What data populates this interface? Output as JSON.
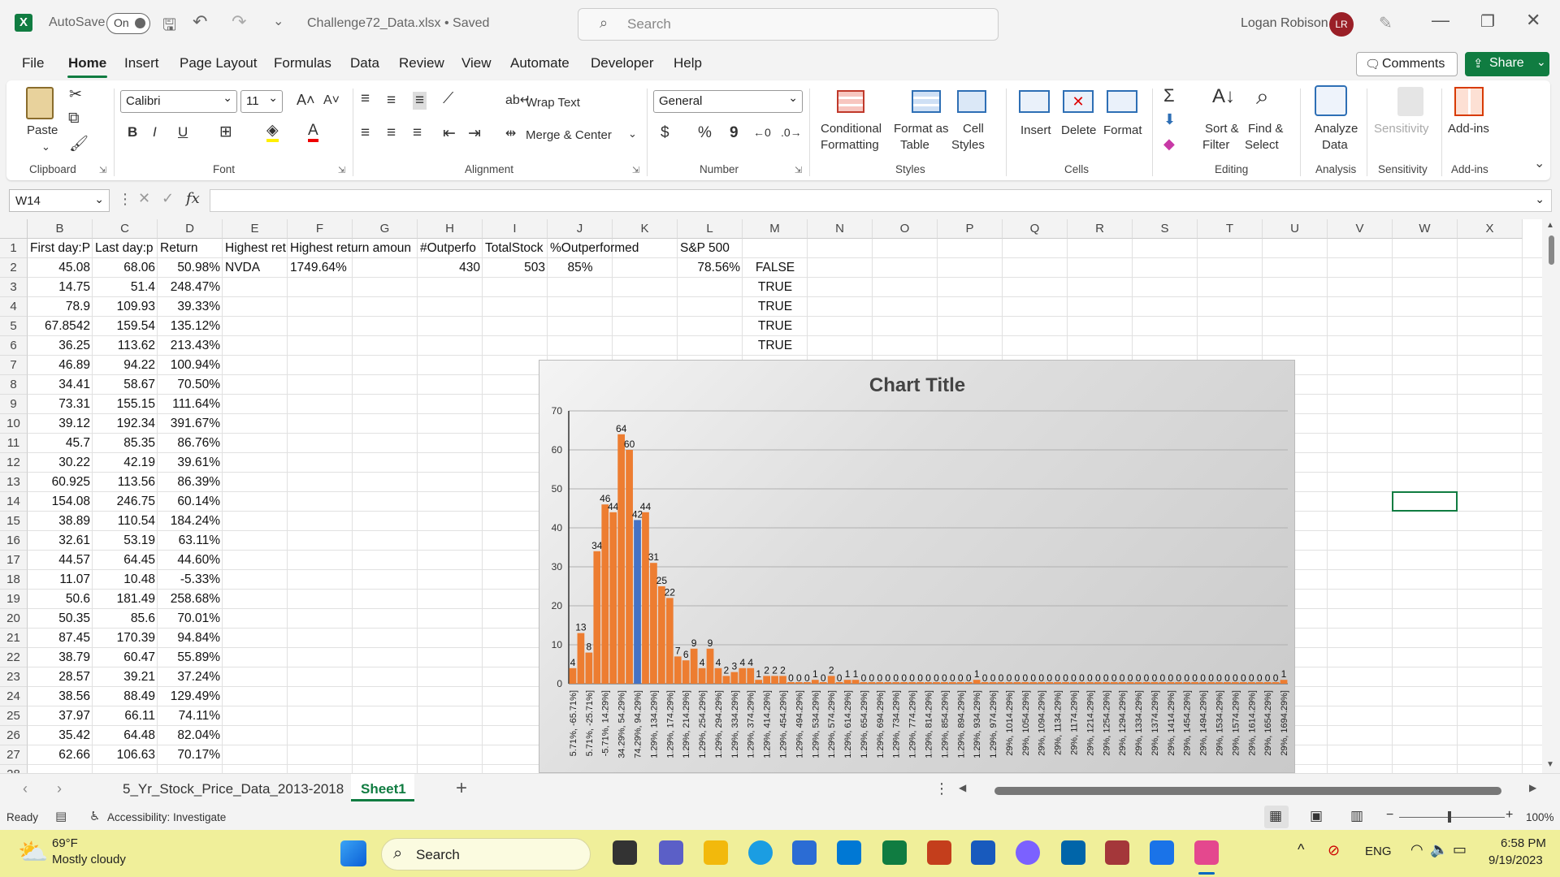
{
  "titlebar": {
    "autosave_label": "AutoSave",
    "autosave_state": "On",
    "filename": "Challenge72_Data.xlsx • Saved",
    "search_placeholder": "Search",
    "user_name": "Logan Robison",
    "user_initials": "LR"
  },
  "menu": {
    "items": [
      "File",
      "Home",
      "Insert",
      "Page Layout",
      "Formulas",
      "Data",
      "Review",
      "View",
      "Automate",
      "Developer",
      "Help"
    ],
    "active": "Home",
    "comments_label": "Comments",
    "share_label": "Share"
  },
  "ribbon": {
    "paste_label": "Paste",
    "clipboard_group": "Clipboard",
    "font_name": "Calibri",
    "font_size": "11",
    "font_group": "Font",
    "wrap_text_label": "Wrap Text",
    "merge_center_label": "Merge & Center",
    "alignment_group": "Alignment",
    "number_format": "General",
    "number_group": "Number",
    "conditional_formatting_label": [
      "Conditional",
      "Formatting"
    ],
    "format_as_table_label": [
      "Format as",
      "Table"
    ],
    "cell_styles_label": [
      "Cell",
      "Styles"
    ],
    "styles_group": "Styles",
    "insert_label": "Insert",
    "delete_label": "Delete",
    "format_label": "Format",
    "cells_group": "Cells",
    "sort_filter_label": [
      "Sort &",
      "Filter"
    ],
    "find_select_label": [
      "Find &",
      "Select"
    ],
    "editing_group": "Editing",
    "analyze_data_label": [
      "Analyze",
      "Data"
    ],
    "analysis_group": "Analysis",
    "sensitivity_label": "Sensitivity",
    "sensitivity_group": "Sensitivity",
    "addins_label": "Add-ins",
    "addins_group": "Add-ins"
  },
  "formula_bar": {
    "name_box": "W14",
    "fx_label": "fx",
    "formula": ""
  },
  "grid": {
    "columns": [
      "B",
      "C",
      "D",
      "E",
      "F",
      "G",
      "H",
      "I",
      "J",
      "K",
      "L",
      "M",
      "N",
      "O",
      "P",
      "Q",
      "R",
      "S",
      "T",
      "U",
      "V",
      "W",
      "X"
    ],
    "header_row": {
      "B": "First day:P",
      "C": "Last day:p",
      "D": "Return",
      "E": "Highest ret",
      "F": "Highest return amoun",
      "H": "#Outperfo",
      "I": "TotalStock",
      "J": "%Outperformed",
      "L": "S&P 500"
    },
    "row2": {
      "E": "NVDA",
      "F": "1749.64%",
      "H": "430",
      "I": "503",
      "J": "85%",
      "L": "78.56%"
    },
    "col_m": [
      "FALSE",
      "TRUE",
      "TRUE",
      "TRUE",
      "TRUE"
    ],
    "rows": [
      [
        "45.08",
        "68.06",
        "50.98%"
      ],
      [
        "14.75",
        "51.4",
        "248.47%"
      ],
      [
        "78.9",
        "109.93",
        "39.33%"
      ],
      [
        "67.8542",
        "159.54",
        "135.12%"
      ],
      [
        "36.25",
        "113.62",
        "213.43%"
      ],
      [
        "46.89",
        "94.22",
        "100.94%"
      ],
      [
        "34.41",
        "58.67",
        "70.50%"
      ],
      [
        "73.31",
        "155.15",
        "111.64%"
      ],
      [
        "39.12",
        "192.34",
        "391.67%"
      ],
      [
        "45.7",
        "85.35",
        "86.76%"
      ],
      [
        "30.22",
        "42.19",
        "39.61%"
      ],
      [
        "60.925",
        "113.56",
        "86.39%"
      ],
      [
        "154.08",
        "246.75",
        "60.14%"
      ],
      [
        "38.89",
        "110.54",
        "184.24%"
      ],
      [
        "32.61",
        "53.19",
        "63.11%"
      ],
      [
        "44.57",
        "64.45",
        "44.60%"
      ],
      [
        "11.07",
        "10.48",
        "-5.33%"
      ],
      [
        "50.6",
        "181.49",
        "258.68%"
      ],
      [
        "50.35",
        "85.6",
        "70.01%"
      ],
      [
        "87.45",
        "170.39",
        "94.84%"
      ],
      [
        "38.79",
        "60.47",
        "55.89%"
      ],
      [
        "28.57",
        "39.21",
        "37.24%"
      ],
      [
        "38.56",
        "88.49",
        "129.49%"
      ],
      [
        "37.97",
        "66.11",
        "74.11%"
      ],
      [
        "35.42",
        "64.48",
        "82.04%"
      ],
      [
        "62.66",
        "106.63",
        "70.17%"
      ]
    ]
  },
  "chart_data": {
    "type": "bar",
    "title": "Chart Title",
    "ylim": [
      0,
      70
    ],
    "yticks": [
      0,
      10,
      20,
      30,
      40,
      50,
      60,
      70
    ],
    "grid": true,
    "highlight_color": "#4472c4",
    "bar_color": "#ed7d31",
    "highlight_index": 8,
    "values": [
      4,
      13,
      8,
      34,
      46,
      44,
      64,
      60,
      42,
      44,
      31,
      25,
      22,
      7,
      6,
      9,
      4,
      9,
      4,
      2,
      3,
      4,
      4,
      1,
      2,
      2,
      2,
      0,
      0,
      0,
      1,
      0,
      2,
      0,
      1,
      1,
      0,
      0,
      0,
      0,
      0,
      0,
      0,
      0,
      0,
      0,
      0,
      0,
      0,
      0,
      1,
      0,
      0,
      0,
      0,
      0,
      0,
      0,
      0,
      0,
      0,
      0,
      0,
      0,
      0,
      0,
      0,
      0,
      0,
      0,
      0,
      0,
      0,
      0,
      0,
      0,
      0,
      0,
      0,
      0,
      0,
      0,
      0,
      0,
      0,
      0,
      0,
      0,
      1
    ],
    "visible_tick_labels": [
      "5.71%, -65.71%]",
      "5.71%, -25.71%]",
      "-5.71%, 14.29%]",
      "34.29%, 54.29%]",
      "74.29%, 94.29%]",
      "1.29%, 134.29%]",
      "1.29%, 174.29%]",
      "1.29%, 214.29%]",
      "1.29%, 254.29%]",
      "1.29%, 294.29%]",
      "1.29%, 334.29%]",
      "1.29%, 374.29%]",
      "1.29%, 414.29%]",
      "1.29%, 454.29%]",
      "1.29%, 494.29%]",
      "1.29%, 534.29%]",
      "1.29%, 574.29%]",
      "1.29%, 614.29%]",
      "1.29%, 654.29%]",
      "1.29%, 694.29%]",
      "1.29%, 734.29%]",
      "1.29%, 774.29%]",
      "1.29%, 814.29%]",
      "1.29%, 854.29%]",
      "1.29%, 894.29%]",
      "1.29%, 934.29%]",
      "1.29%, 974.29%]",
      "29%, 1014.29%]",
      "29%, 1054.29%]",
      "29%, 1094.29%]",
      "29%, 1134.29%]",
      "29%, 1174.29%]",
      "29%, 1214.29%]",
      "29%, 1254.29%]",
      "29%, 1294.29%]",
      "29%, 1334.29%]",
      "29%, 1374.29%]",
      "29%, 1414.29%]",
      "29%, 1454.29%]",
      "29%, 1494.29%]",
      "29%, 1534.29%]",
      "29%, 1574.29%]",
      "29%, 1614.29%]",
      "29%, 1654.29%]",
      "29%, 1694.29%]",
      "29%, 1734.29%]"
    ]
  },
  "sheets": {
    "tabs": [
      "5_Yr_Stock_Price_Data_2013-2018",
      "Sheet1"
    ],
    "active": "Sheet1"
  },
  "status": {
    "ready": "Ready",
    "accessibility": "Accessibility: Investigate",
    "zoom": "100%"
  },
  "taskbar": {
    "weather_temp": "69°F",
    "weather_desc": "Mostly cloudy",
    "search_label": "Search",
    "language": "ENG",
    "time": "6:58 PM",
    "date": "9/19/2023"
  }
}
